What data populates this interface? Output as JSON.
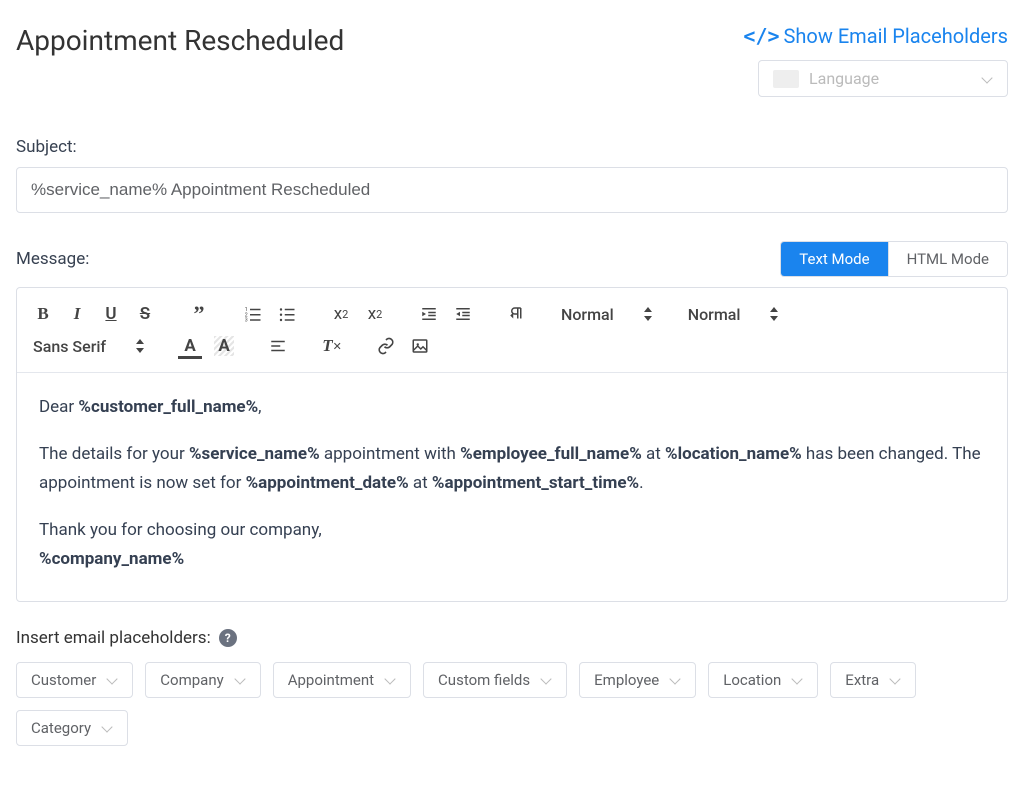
{
  "header": {
    "title": "Appointment Rescheduled",
    "show_placeholders_label": "Show Email Placeholders",
    "language_placeholder": "Language"
  },
  "subject": {
    "label": "Subject:",
    "value": "%service_name% Appointment Rescheduled"
  },
  "message": {
    "label": "Message:",
    "text_mode_label": "Text Mode",
    "html_mode_label": "HTML Mode",
    "active_mode": "text"
  },
  "toolbar": {
    "paragraph_picker": "Normal",
    "heading_picker": "Normal",
    "font_picker": "Sans Serif"
  },
  "body": {
    "greeting_prefix": "Dear ",
    "greeting_placeholder": "%customer_full_name%",
    "greeting_suffix": ",",
    "line2_a": "The details for your ",
    "line2_ph1": "%service_name%",
    "line2_b": " appointment with ",
    "line2_ph2": "%employee_full_name%",
    "line2_c": " at ",
    "line2_ph3": "%location_name%",
    "line2_d": " has been changed. The appointment is now set for ",
    "line2_ph4": "%appointment_date%",
    "line2_e": " at ",
    "line2_ph5": "%appointment_start_time%",
    "line2_f": ".",
    "thanks": " Thank you for choosing our company,",
    "company_ph": "%company_name%"
  },
  "insert": {
    "label": "Insert email placeholders:",
    "chips": [
      "Customer",
      "Company",
      "Appointment",
      "Custom fields",
      "Employee",
      "Location",
      "Extra",
      "Category"
    ]
  }
}
